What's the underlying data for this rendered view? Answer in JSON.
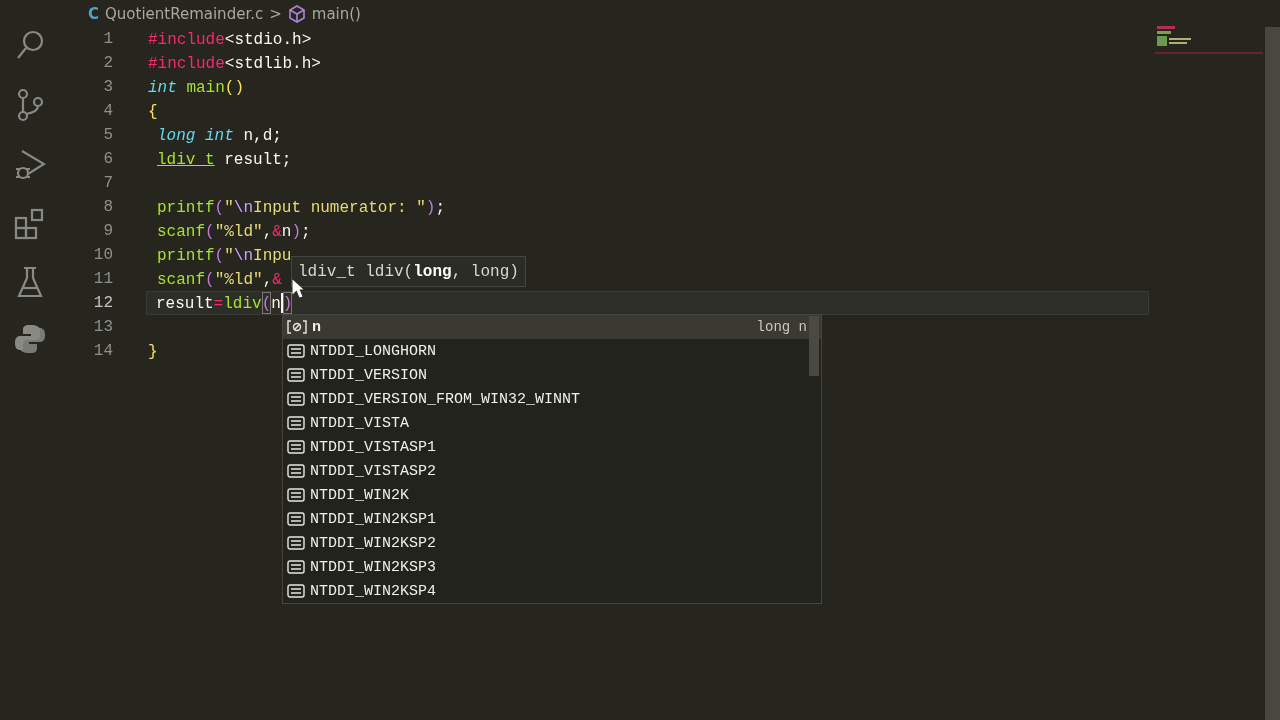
{
  "breadcrumb": {
    "file_icon": "C",
    "file": "QuotientRemainder.c",
    "separator": ">",
    "symbol": "main()"
  },
  "activity_bar": [
    {
      "kind": "search"
    },
    {
      "kind": "source-control"
    },
    {
      "kind": "run-debug"
    },
    {
      "kind": "extensions"
    },
    {
      "kind": "testing"
    },
    {
      "kind": "python"
    }
  ],
  "lines": [
    {
      "number": "1",
      "current": false,
      "indented": false,
      "tokens": [
        {
          "kind": "directive",
          "text": "#include"
        },
        {
          "kind": "plain",
          "text": "<stdio.h>"
        }
      ]
    },
    {
      "number": "2",
      "current": false,
      "indented": false,
      "tokens": [
        {
          "kind": "directive",
          "text": "#include"
        },
        {
          "kind": "plain",
          "text": "<stdlib.h>"
        }
      ]
    },
    {
      "number": "3",
      "current": false,
      "indented": false,
      "tokens": [
        {
          "kind": "type",
          "text": "int "
        },
        {
          "kind": "function",
          "text": "main"
        },
        {
          "kind": "bracket1",
          "text": "()"
        }
      ]
    },
    {
      "number": "4",
      "current": false,
      "indented": false,
      "tokens": [
        {
          "kind": "bracket1",
          "text": "{"
        }
      ]
    },
    {
      "number": "5",
      "current": false,
      "indented": true,
      "tokens": [
        {
          "kind": "type",
          "text": "long "
        },
        {
          "kind": "type",
          "text": "int "
        },
        {
          "kind": "plain",
          "text": "n,d;"
        }
      ]
    },
    {
      "number": "6",
      "current": false,
      "indented": true,
      "tokens": [
        {
          "kind": "typename",
          "text": "ldiv_t"
        },
        {
          "kind": "plain",
          "text": " result;"
        }
      ]
    },
    {
      "number": "7",
      "current": false,
      "indented": false
    },
    {
      "number": "8",
      "current": false,
      "indented": true,
      "tokens": [
        {
          "kind": "function",
          "text": "printf"
        },
        {
          "kind": "bracket2",
          "text": "("
        },
        {
          "kind": "string",
          "text": "\""
        },
        {
          "kind": "escape",
          "text": "\\n"
        },
        {
          "kind": "string",
          "text": "Input numerator: \""
        },
        {
          "kind": "bracket2",
          "text": ")"
        },
        {
          "kind": "plain",
          "text": ";"
        }
      ]
    },
    {
      "number": "9",
      "current": false,
      "indented": true,
      "tokens": [
        {
          "kind": "function",
          "text": "scanf"
        },
        {
          "kind": "bracket2",
          "text": "("
        },
        {
          "kind": "string",
          "text": "\"%ld\""
        },
        {
          "kind": "plain",
          "text": ","
        },
        {
          "kind": "operator",
          "text": "&"
        },
        {
          "kind": "plain",
          "text": "n"
        },
        {
          "kind": "bracket2",
          "text": ")"
        },
        {
          "kind": "plain",
          "text": ";"
        }
      ]
    },
    {
      "number": "10",
      "current": false,
      "indented": true,
      "tokens": [
        {
          "kind": "function",
          "text": "printf"
        },
        {
          "kind": "bracket2",
          "text": "("
        },
        {
          "kind": "string",
          "text": "\""
        },
        {
          "kind": "escape",
          "text": "\\n"
        },
        {
          "kind": "string",
          "text": "Inpu"
        }
      ]
    },
    {
      "number": "11",
      "current": false,
      "indented": true,
      "tokens": [
        {
          "kind": "function",
          "text": "scanf"
        },
        {
          "kind": "bracket2",
          "text": "("
        },
        {
          "kind": "string",
          "text": "\"%ld\""
        },
        {
          "kind": "plain",
          "text": ","
        },
        {
          "kind": "operator",
          "text": "&"
        }
      ]
    },
    {
      "number": "12",
      "current": true,
      "indented": true,
      "tokens": [
        {
          "kind": "plain",
          "text": "result"
        },
        {
          "kind": "operator",
          "text": "="
        },
        {
          "kind": "function",
          "text": "ldiv"
        },
        {
          "kind": "match",
          "text": "("
        },
        {
          "kind": "plain",
          "text": "n"
        },
        {
          "kind": "caret"
        },
        {
          "kind": "match",
          "text": ")"
        }
      ]
    },
    {
      "number": "13",
      "current": false,
      "indented": false
    },
    {
      "number": "14",
      "current": false,
      "indented": false,
      "tokens": [
        {
          "kind": "bracket1",
          "text": "}"
        }
      ]
    }
  ],
  "parameter_hint": "ldiv_t ldiv(**long**, long)",
  "suggestions": [
    {
      "kind": "variable",
      "label": "n",
      "detail": "long n",
      "selected": true
    },
    {
      "kind": "constant",
      "label": "NTDDI_LONGHORN",
      "selected": false
    },
    {
      "kind": "constant",
      "label": "NTDDI_VERSION",
      "selected": false
    },
    {
      "kind": "constant",
      "label": "NTDDI_VERSION_FROM_WIN32_WINNT",
      "selected": false
    },
    {
      "kind": "constant",
      "label": "NTDDI_VISTA",
      "selected": false
    },
    {
      "kind": "constant",
      "label": "NTDDI_VISTASP1",
      "selected": false
    },
    {
      "kind": "constant",
      "label": "NTDDI_VISTASP2",
      "selected": false
    },
    {
      "kind": "constant",
      "label": "NTDDI_WIN2K",
      "selected": false
    },
    {
      "kind": "constant",
      "label": "NTDDI_WIN2KSP1",
      "selected": false
    },
    {
      "kind": "constant",
      "label": "NTDDI_WIN2KSP2",
      "selected": false
    },
    {
      "kind": "constant",
      "label": "NTDDI_WIN2KSP3",
      "selected": false
    },
    {
      "kind": "constant",
      "label": "NTDDI_WIN2KSP4",
      "selected": false
    }
  ]
}
